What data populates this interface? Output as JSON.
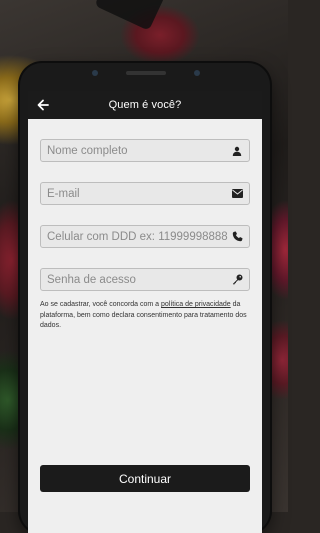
{
  "header": {
    "title": "Quem é você?"
  },
  "form": {
    "name_placeholder": "Nome completo",
    "email_placeholder": "E-mail",
    "phone_placeholder": "Celular com DDD ex: 11999998888",
    "password_placeholder": "Senha de acesso"
  },
  "terms": {
    "prefix": "Ao se cadastrar, você concorda com a ",
    "link": "política de privacidade",
    "suffix": " da plataforma, bem como declara consentimento para tratamento dos dados."
  },
  "actions": {
    "continue_label": "Continuar"
  },
  "icons": {
    "back": "arrow-left-icon",
    "name": "user-icon",
    "email": "envelope-icon",
    "phone": "phone-icon",
    "password": "key-icon"
  },
  "colors": {
    "appbar": "#1b1b1b",
    "button": "#1b1b1b",
    "screen_bg": "#efefef"
  }
}
